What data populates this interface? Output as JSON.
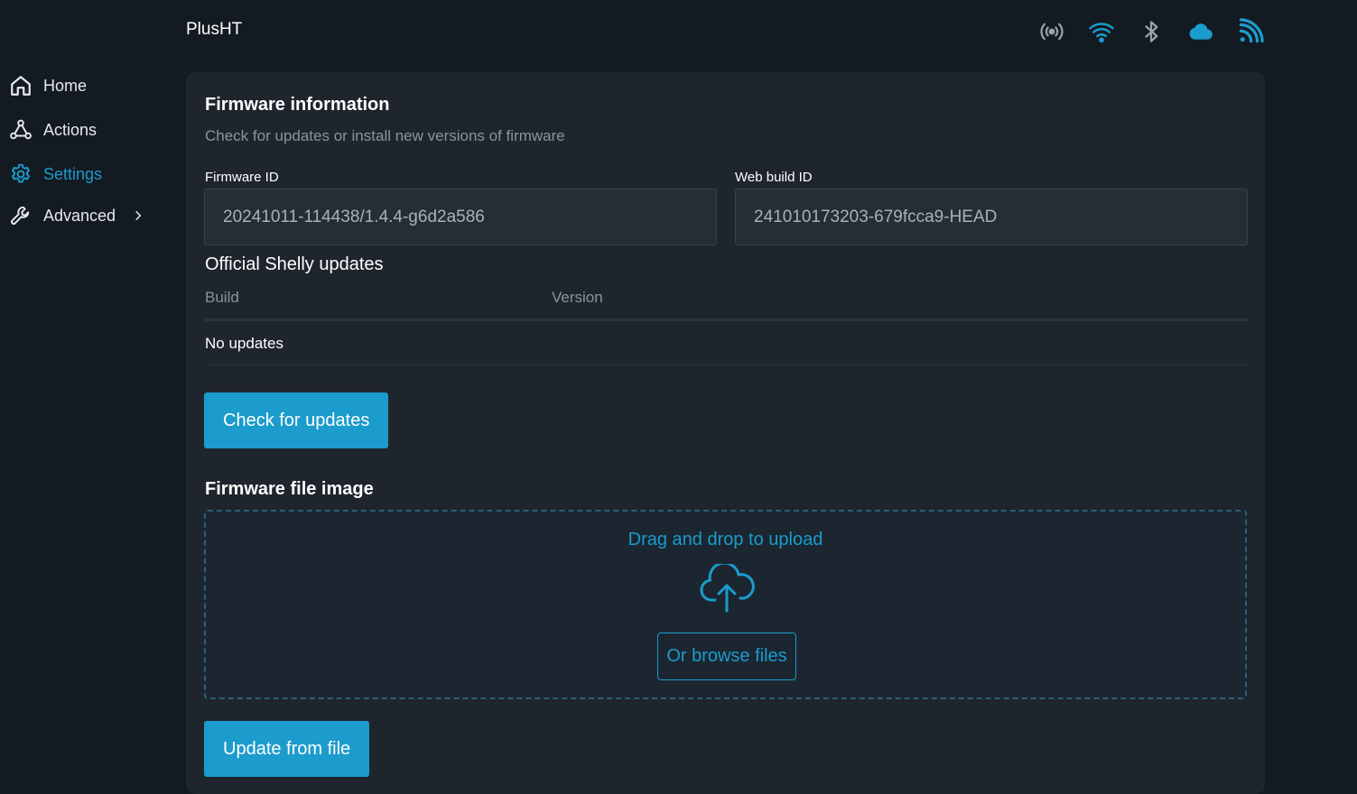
{
  "app": {
    "title": "PlusHT"
  },
  "sidebar": {
    "items": [
      {
        "label": "Home",
        "icon": "home-icon"
      },
      {
        "label": "Actions",
        "icon": "actions-icon"
      },
      {
        "label": "Settings",
        "icon": "gear-icon",
        "active": true
      },
      {
        "label": "Advanced",
        "icon": "wrench-icon",
        "expandable": true
      }
    ]
  },
  "status_icons": [
    "broadcast-icon",
    "wifi-icon",
    "bluetooth-icon",
    "cloud-icon",
    "rss-icon"
  ],
  "colors": {
    "accent": "#1b9ccc",
    "background": "#131a22",
    "card": "#1e252d"
  },
  "firmware": {
    "title": "Firmware information",
    "subtitle": "Check for updates or install new versions of firmware",
    "firmware_id_label": "Firmware ID",
    "firmware_id_value": "20241011-114438/1.4.4-g6d2a586",
    "web_build_label": "Web build ID",
    "web_build_value": "241010173203-679fcca9-HEAD"
  },
  "updates": {
    "heading": "Official Shelly updates",
    "columns": [
      "Build",
      "Version"
    ],
    "empty_text": "No updates",
    "check_button": "Check for updates"
  },
  "file_image": {
    "heading": "Firmware file image",
    "drop_text": "Drag and drop to upload",
    "browse_button": "Or browse files",
    "update_button": "Update from file"
  }
}
